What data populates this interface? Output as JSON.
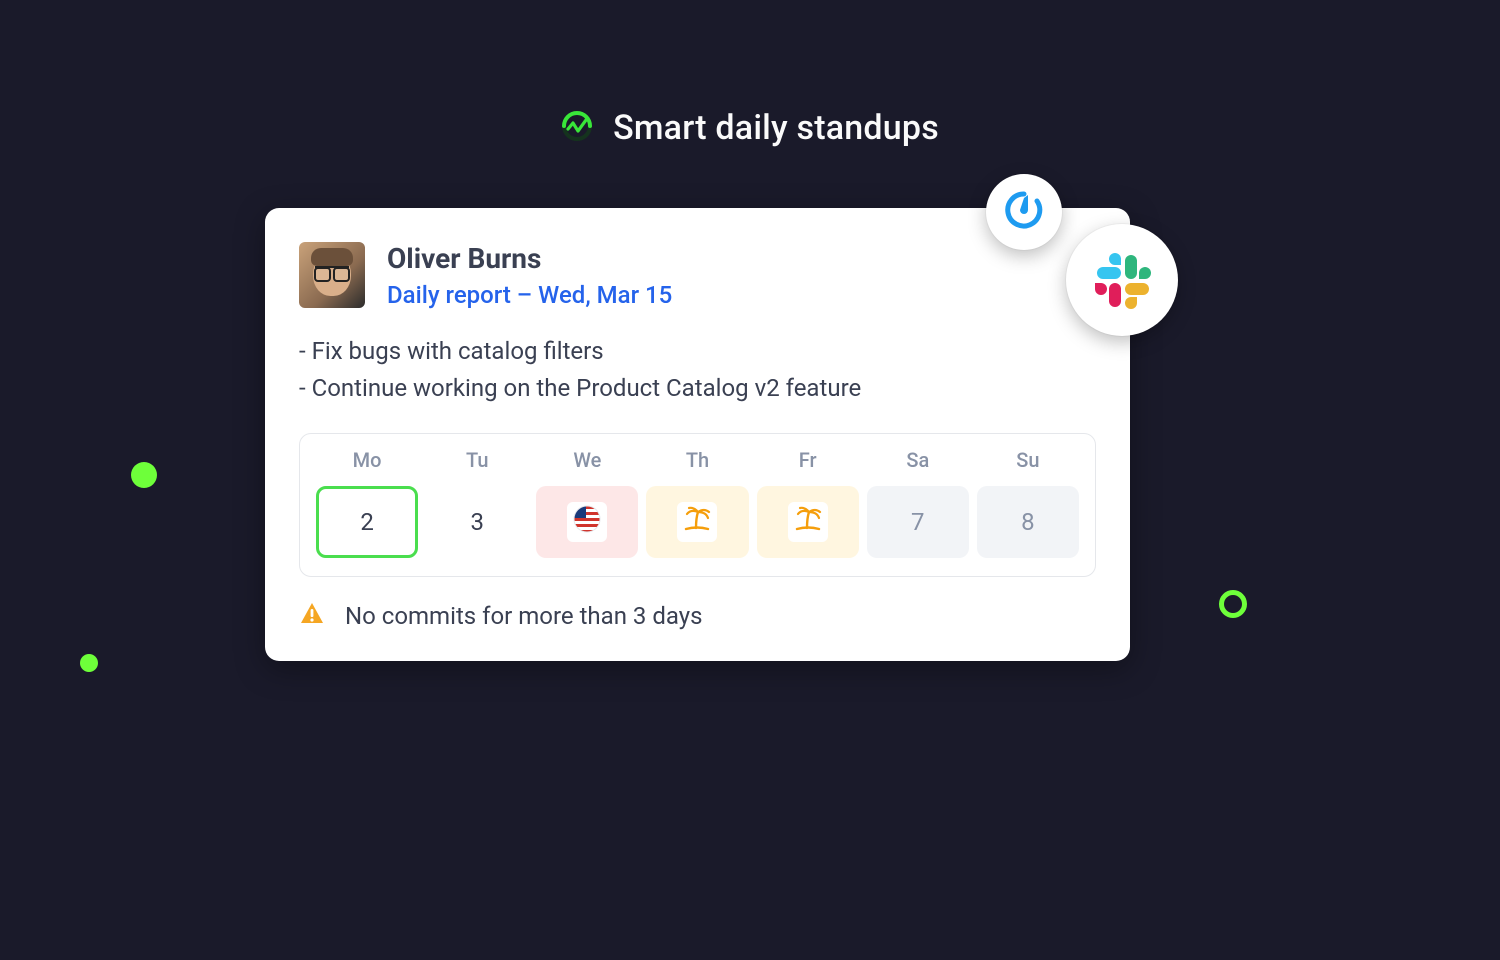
{
  "header": {
    "title": "Smart daily standups",
    "icon": "app-logo-icon"
  },
  "card": {
    "user_name": "Oliver Burns",
    "report_link": "Daily report – Wed, Mar 15",
    "bullets": [
      "Fix bugs with catalog filters",
      "Continue working on the Product Catalog v2 feature"
    ],
    "bullets_joined": "- Fix bugs with catalog filters\n- Continue working on the Product Catalog v2 feature",
    "alert_text": "No commits for more than 3 days"
  },
  "week": {
    "labels": [
      "Mo",
      "Tu",
      "We",
      "Th",
      "Fr",
      "Sa",
      "Su"
    ],
    "days": [
      {
        "type": "count",
        "value": "2",
        "style": "outlined"
      },
      {
        "type": "count",
        "value": "3",
        "style": "plain"
      },
      {
        "type": "icon",
        "icon": "us-flag-icon",
        "style": "pink"
      },
      {
        "type": "icon",
        "icon": "palm-icon",
        "style": "cream"
      },
      {
        "type": "icon",
        "icon": "palm-icon",
        "style": "cream"
      },
      {
        "type": "count",
        "value": "7",
        "style": "grey"
      },
      {
        "type": "count",
        "value": "8",
        "style": "grey"
      }
    ]
  },
  "integrations": {
    "small_badge_icon": "mattermost-icon",
    "large_badge_icon": "slack-icon"
  },
  "colors": {
    "accent_green": "#4ade4e",
    "link_blue": "#2563eb",
    "warning_orange": "#f59e0b"
  }
}
